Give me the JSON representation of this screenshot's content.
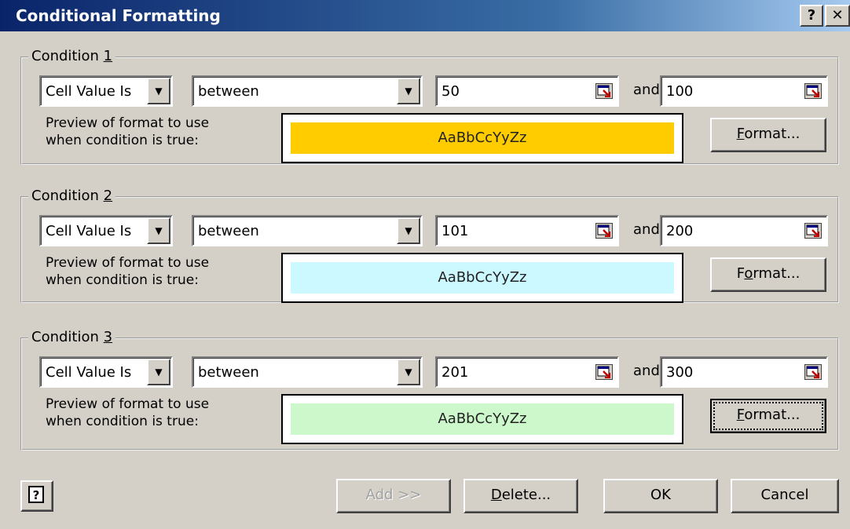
{
  "window": {
    "title": "Conditional Formatting",
    "help_glyph": "?",
    "close_glyph": "✕"
  },
  "conditions": [
    {
      "label_prefix": "Condition ",
      "label_key": "1",
      "type": "Cell Value Is",
      "operator": "between",
      "value1": "50",
      "and_label": "and",
      "value2": "100",
      "preview_label_1": "Preview of format to use",
      "preview_label_2": "when condition is true:",
      "preview_text": "AaBbCcYyZz",
      "preview_color": "#ffcc00",
      "format_key": "F",
      "format_rest": "ormat..."
    },
    {
      "label_prefix": "Condition ",
      "label_key": "2",
      "type": "Cell Value Is",
      "operator": "between",
      "value1": "101",
      "and_label": "and",
      "value2": "200",
      "preview_label_1": "Preview of format to use",
      "preview_label_2": "when condition is true:",
      "preview_text": "AaBbCcYyZz",
      "preview_color": "#ccf8ff",
      "format_pre": "F",
      "format_key": "o",
      "format_rest": "rmat..."
    },
    {
      "label_prefix": "Condition ",
      "label_key": "3",
      "type": "Cell Value Is",
      "operator": "between",
      "value1": "201",
      "and_label": "and",
      "value2": "300",
      "preview_label_1": "Preview of format to use",
      "preview_label_2": "when condition is true:",
      "preview_text": "AaBbCcYyZz",
      "preview_color": "#ccf8cc",
      "format_key": "F",
      "format_rest": "ormat..."
    }
  ],
  "footer": {
    "add_label": "Add >>",
    "delete_key": "D",
    "delete_rest": "elete...",
    "ok_label": "OK",
    "cancel_label": "Cancel"
  }
}
